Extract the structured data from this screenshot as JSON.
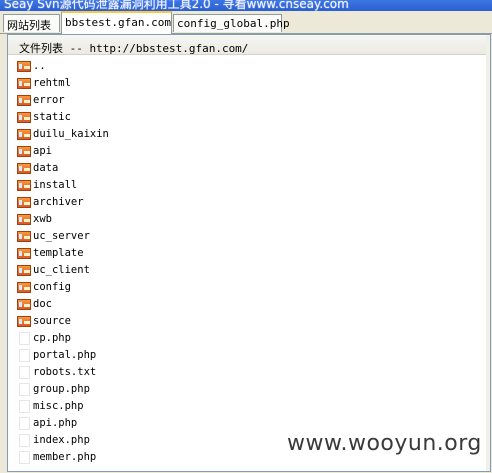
{
  "window": {
    "title": "Seay Svn源代码泄露漏洞利用工具2.0 - 寻看www.cnseay.com"
  },
  "tabs": [
    {
      "label": "网站列表"
    },
    {
      "label": "bbstest.gfan.com"
    },
    {
      "label": "config_global.php"
    }
  ],
  "active_tab": "bbstest.gfan.com",
  "panel": {
    "header": "文件列表 -- http://bbstest.gfan.com/"
  },
  "items": [
    {
      "name": "..",
      "type": "folder"
    },
    {
      "name": "rehtml",
      "type": "folder"
    },
    {
      "name": "error",
      "type": "folder"
    },
    {
      "name": "static",
      "type": "folder"
    },
    {
      "name": "duilu_kaixin",
      "type": "folder"
    },
    {
      "name": "api",
      "type": "folder"
    },
    {
      "name": "data",
      "type": "folder"
    },
    {
      "name": "install",
      "type": "folder"
    },
    {
      "name": "archiver",
      "type": "folder"
    },
    {
      "name": "xwb",
      "type": "folder"
    },
    {
      "name": "uc_server",
      "type": "folder"
    },
    {
      "name": "template",
      "type": "folder"
    },
    {
      "name": "uc_client",
      "type": "folder"
    },
    {
      "name": "config",
      "type": "folder"
    },
    {
      "name": "doc",
      "type": "folder"
    },
    {
      "name": "source",
      "type": "folder"
    },
    {
      "name": "cp.php",
      "type": "file"
    },
    {
      "name": "portal.php",
      "type": "file"
    },
    {
      "name": "robots.txt",
      "type": "file"
    },
    {
      "name": "group.php",
      "type": "file"
    },
    {
      "name": "misc.php",
      "type": "file"
    },
    {
      "name": "api.php",
      "type": "file"
    },
    {
      "name": "index.php",
      "type": "file"
    },
    {
      "name": "member.php",
      "type": "file"
    }
  ],
  "watermark": "www.wooyun.org",
  "colors": {
    "folder_icon": "#e8702f",
    "title_bar": "#2f65d6",
    "active_tab_accent": "#ffc83c"
  }
}
